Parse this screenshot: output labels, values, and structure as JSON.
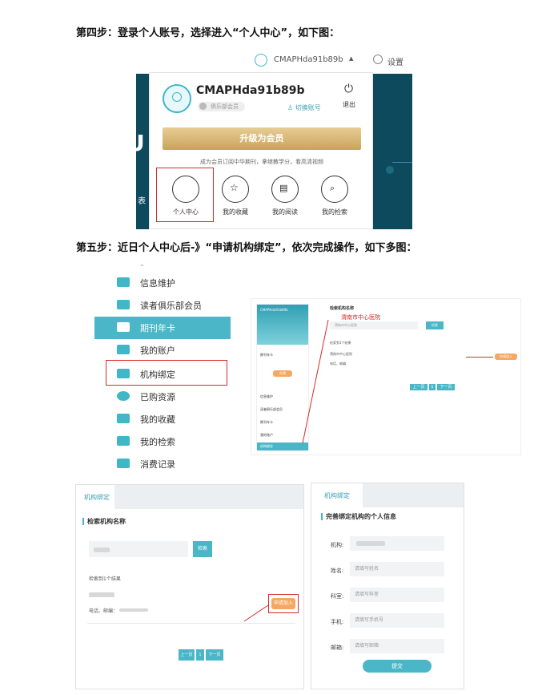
{
  "steps": {
    "step4": "第四步：登录个人账号，选择进入“个人中心”，如下图：",
    "step5": "第五步：近日个人中心后-》“申请机构绑定”，依次完成操作，如下多图："
  },
  "panel1": {
    "topbar_user": "CMAPHda91b89b",
    "topbar_settings": "设置",
    "username": "CMAPHda91b89b",
    "member_badge": "俱乐部会员",
    "switch_account": "切换账号",
    "logout": "退出",
    "upgrade_button": "升级为会员",
    "promo_text": "成为会员订阅中华期刊，拿继教学分，看高清视频",
    "bg_text": "表",
    "bg_big": "U",
    "shortcuts": [
      "个人中心",
      "我的收藏",
      "我的阅读",
      "我的检索"
    ]
  },
  "menu": {
    "items": [
      "信息维护",
      "读者俱乐部会员",
      "期刊年卡",
      "我的账户",
      "机构绑定",
      "已购资源",
      "我的收藏",
      "我的检索",
      "消费记录"
    ]
  },
  "panel3": {
    "header_user": "CMAPHda91b89b",
    "section_title": "检索机构名称",
    "annotation": "渭南市中心医院",
    "search_value": "渭南市中心医院",
    "search_button": "检索",
    "result_count": "检索到1个结果",
    "result_name": "渭南市中心医院",
    "result_detail": "电话、邮编：",
    "apply_button": "申请加入",
    "sidebar_card": "期刊年卡",
    "sidebar_btn": "办理",
    "menu_items": [
      "信息维护",
      "读者俱乐部会员",
      "期刊年卡",
      "我的账户",
      "机构绑定"
    ],
    "pager": [
      "上一页",
      "1",
      "下一页"
    ]
  },
  "panel4": {
    "tab": "机构绑定",
    "section_title": "检索机构名称",
    "search_button": "检索",
    "result_count": "检索到1个结果",
    "result_detail": "电话、邮编：",
    "apply_button": "申请加入",
    "pager": [
      "上一页",
      "1",
      "下一页"
    ]
  },
  "panel5": {
    "tab": "机构绑定",
    "section_title": "完善绑定机构的个人信息",
    "fields": [
      {
        "label": "机构:",
        "placeholder": ""
      },
      {
        "label": "姓名:",
        "placeholder": "请填写姓名"
      },
      {
        "label": "科室:",
        "placeholder": "请填写科室"
      },
      {
        "label": "手机:",
        "placeholder": "请填写手机号"
      },
      {
        "label": "邮箱:",
        "placeholder": "请填写邮箱"
      }
    ],
    "submit": "提交"
  }
}
